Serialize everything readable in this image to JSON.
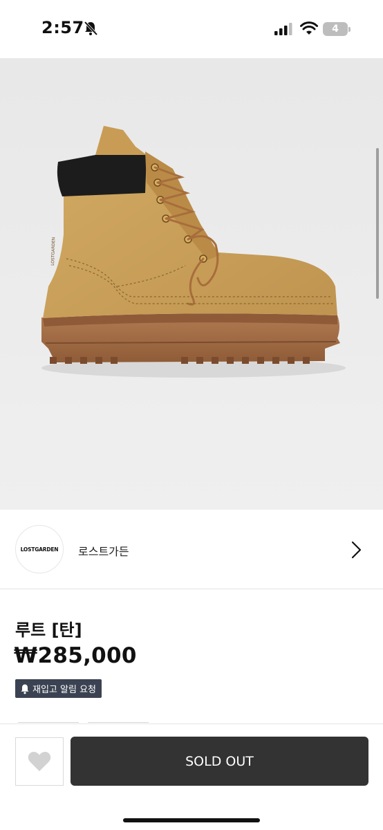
{
  "status_bar": {
    "time": "2:57",
    "battery_level": "4",
    "icons": [
      "bell-off-icon",
      "signal-icon",
      "wifi-icon",
      "battery-icon"
    ]
  },
  "product_image": {
    "logo_text": "LOSTGARDEN"
  },
  "brand": {
    "logo_text": "LOSTGARDEN",
    "name": "로스트가든"
  },
  "product": {
    "title": "루트 [탄]",
    "price": "₩285,000",
    "restock_label": "재입고 알림 요청"
  },
  "bottom_bar": {
    "soldout_label": "SOLD OUT"
  },
  "colors": {
    "primary_dark": "#333333",
    "restock_bg": "#3b4352",
    "image_bg": "#ebebeb",
    "boot_tan": "#c9a05a",
    "sole_brown": "#a06a44"
  }
}
